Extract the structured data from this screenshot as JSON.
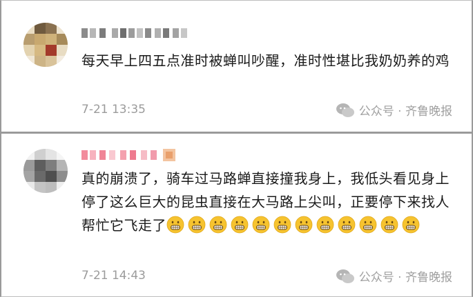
{
  "comments": [
    {
      "username": "TK CSBWH ALL",
      "text": "每天早上四五点准时被蝉叫吵醒，准时性堪比我奶奶养的鸡",
      "time": "7-21 13:35",
      "watermark": "公众号 · 齐鲁晚报",
      "avatar_icon": "blurred-avatar-icon"
    },
    {
      "username": "HF Fo J",
      "text": "真的崩溃了，骑车过马路蝉直接撞我身上，我低头看见身上停了这么巨大的昆虫直接在大马路上尖叫，正要停下来找人帮忙它飞走了",
      "emoji_count": 12,
      "emoji_icon": "grimace-emoji-icon",
      "time": "7-21 14:43",
      "watermark": "公众号 · 齐鲁晚报",
      "avatar_icon": "blurred-avatar-icon"
    }
  ],
  "colors": {
    "text": "#1a1a1a",
    "meta": "#9b9b9b",
    "border": "#9a9a9a",
    "username_pink": "#f28b9c",
    "emoji_yellow": "#f6c32f"
  }
}
